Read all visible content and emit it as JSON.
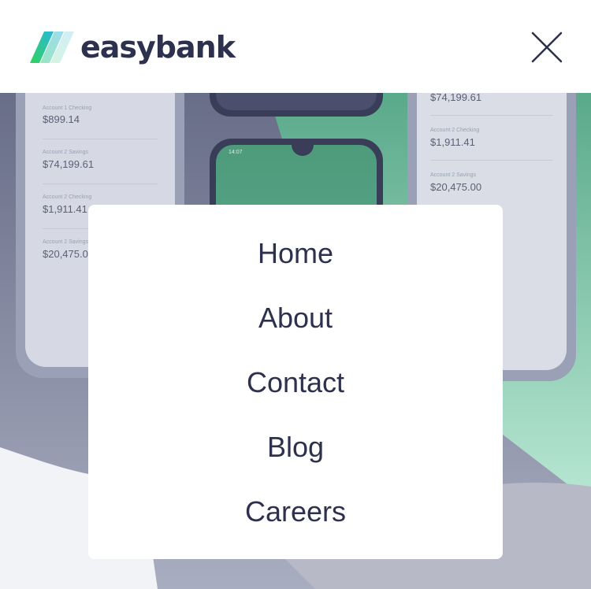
{
  "header": {
    "brand": "easybank",
    "logo_icon": "easybank-logo-stripes",
    "close_icon": "close-x-icon"
  },
  "background": {
    "left_phone": {
      "accounts": [
        {
          "label": "Account 1 Checking",
          "value": "$899.14"
        },
        {
          "label": "Account 2 Savings",
          "value": "$74,199.61"
        },
        {
          "label": "Account 2 Checking",
          "value": "$1,911.41"
        },
        {
          "label": "Account 2 Savings",
          "value": "$20,475.00"
        }
      ]
    },
    "right_phone": {
      "accounts": [
        {
          "label": "",
          "value": "$74,199.61"
        },
        {
          "label": "Account 2 Checking",
          "value": "$1,911.41"
        },
        {
          "label": "Account 2 Savings",
          "value": "$20,475.00"
        }
      ]
    },
    "middle_phone": {
      "time": "14:07"
    }
  },
  "menu": {
    "items": [
      {
        "label": "Home"
      },
      {
        "label": "About"
      },
      {
        "label": "Contact"
      },
      {
        "label": "Blog"
      },
      {
        "label": "Careers"
      }
    ]
  },
  "colors": {
    "brand_dark": "#2d314d",
    "lime_green": "#31d35c",
    "bright_cyan": "#2bb7da",
    "overlay_grey": "#9ea0b6"
  }
}
